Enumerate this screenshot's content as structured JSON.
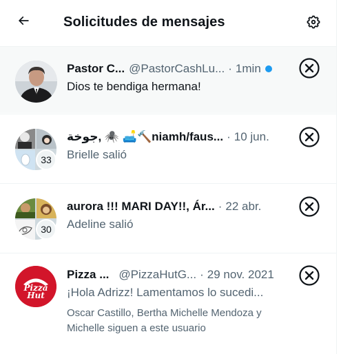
{
  "header": {
    "title": "Solicitudes de mensajes",
    "back_icon": "arrow-left-icon",
    "settings_icon": "gear-icon"
  },
  "requests": [
    {
      "name": "Pastor C...",
      "handle": "@PastorCashLu...",
      "time": "1min",
      "unread": true,
      "message": "Dios te bendiga hermana!"
    },
    {
      "name": "جوخة, 🕷️ 🛋️🔨niamh/faus...",
      "time": "10 jun.",
      "message": "Brielle salió",
      "member_count": "33"
    },
    {
      "name": "aurora !!! MARI DAY!!, Ár...",
      "time": "22 abr.",
      "message": "Adeline salió",
      "member_count": "30"
    },
    {
      "name": "Pizza ...",
      "handle": "@PizzaHutG...",
      "time": "29 nov. 2021",
      "message": "¡Hola Adrizz! Lamentamos lo sucedi...",
      "followers_text": "Oscar Castillo, Bertha Michelle Mendoza y Michelle siguen a este usuario",
      "avatar_logo_text": "Pizza Hut"
    }
  ],
  "separator": "·",
  "colors": {
    "accent": "#1d9bf0",
    "active_row_bg": "#f7f9f9",
    "secondary_text": "#536471",
    "pizza_hut_red": "#d2152a"
  }
}
